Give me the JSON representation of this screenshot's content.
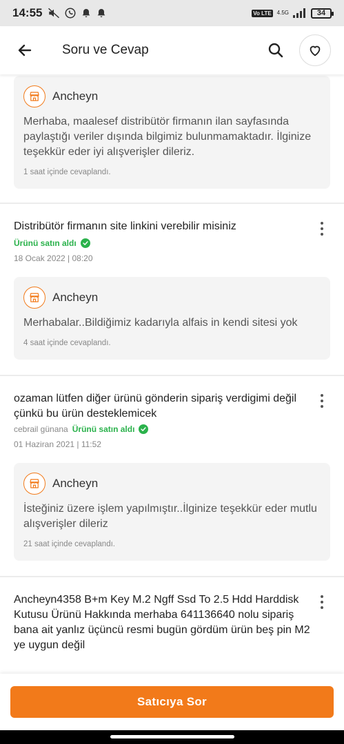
{
  "status_bar": {
    "time": "14:55",
    "network": "4.5G",
    "volte": "Vo LTE",
    "battery": "34"
  },
  "header": {
    "title": "Soru ve Cevap",
    "back_icon": "arrow-left-icon",
    "search_icon": "search-icon",
    "favorite_icon": "heart-icon"
  },
  "qa_items": [
    {
      "answer": {
        "seller": "Ancheyn",
        "text": "Merhaba, maalesef distribütör firmanın ilan sayfasında paylaştığı veriler dışında bilgimiz bulunmamaktadır. İlginize teşekkür eder iyi alışverişler dileriz.",
        "time": "1 saat içinde cevaplandı."
      }
    },
    {
      "question": "Distribütör firmanın site linkini verebilir misiniz",
      "asker": "",
      "bought_label": "Ürünü satın aldı",
      "date": "18 Ocak 2022 | 08:20",
      "answer": {
        "seller": "Ancheyn",
        "text": "Merhabalar..Bildiğimiz kadarıyla alfais in kendi sitesi yok",
        "time": "4 saat içinde cevaplandı."
      }
    },
    {
      "question": "ozaman lütfen diğer ürünü gönderin sipariş verdigimi değil çünkü bu ürün desteklemicek",
      "asker": "cebrail günana",
      "bought_label": "Ürünü satın aldı",
      "date": "01 Haziran 2021 | 11:52",
      "answer": {
        "seller": "Ancheyn",
        "text": "İsteğiniz üzere işlem yapılmıştır..İlginize teşekkür eder mutlu alışverişler dileriz",
        "time": "21 saat içinde cevaplandı."
      }
    },
    {
      "question": "Ancheyn4358 B+m Key M.2 Ngff Ssd To 2.5 Hdd Harddisk Kutusu Ürünü Hakkında  merhaba 641136640 nolu sipariş bana ait yanlız üçüncü resmi bugün gördüm ürün beş pin M2 ye uygun değil"
    }
  ],
  "bottom": {
    "ask_button": "Satıcıya Sor"
  },
  "colors": {
    "accent": "#f27a1a",
    "verified": "#2bb24c"
  }
}
